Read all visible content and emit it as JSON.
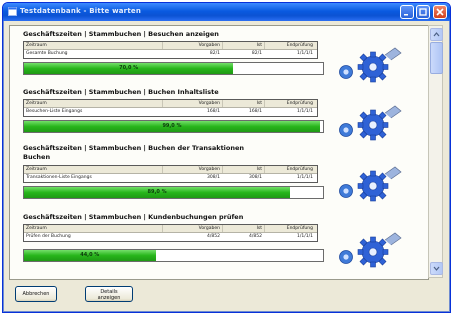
{
  "window": {
    "title": "Testdatenbank - Bitte warten",
    "icon": "app-window-icon",
    "controls": [
      "minimize-icon",
      "maximize-icon",
      "close-icon"
    ]
  },
  "table_headers": {
    "name": "Zeitraum",
    "col1": "Vorgaben",
    "col2": "Ist",
    "col3": "Endprüfung"
  },
  "sections": [
    {
      "title": "Geschäftszeiten | Stammbuchen | Besuchen anzeigen",
      "row": {
        "name": "Gesamte Buchung",
        "col1": "82/1",
        "col2": "82/1",
        "col3": "1/1/1/1"
      },
      "progress": {
        "value": 0.7,
        "label": "70,0 %"
      }
    },
    {
      "title": "Geschäftszeiten | Stammbuchen | Buchen Inhaltsliste",
      "row": {
        "name": "Besuchen-Liste Eingangs",
        "col1": "168/1",
        "col2": "168/1",
        "col3": "1/1/1/1"
      },
      "progress": {
        "value": 0.99,
        "label": "99,0 %"
      }
    },
    {
      "title": "Geschäftszeiten | Stammbuchen | Buchen der Transaktionen",
      "subtitle": "Buchen",
      "row": {
        "name": "Transaktionen-Liste Eingangs",
        "col1": "308/1",
        "col2": "308/1",
        "col3": "1/1/1/1"
      },
      "progress": {
        "value": 0.89,
        "label": "89,0 %"
      }
    },
    {
      "title": "Geschäftszeiten | Stammbuchen | Kundenbuchungen prüfen",
      "row": {
        "name": "Prüfen der Buchung",
        "col1": "4/852",
        "col2": "4/852",
        "col3": "1/1/1/1"
      },
      "progress": {
        "value": 0.44,
        "label": "44,0 %"
      }
    }
  ],
  "footer": {
    "cancel_label": "Abbrechen",
    "details_line1": "Details",
    "details_line2": "anzeigen"
  },
  "colors": {
    "progress": "#27b51a",
    "gear_large": "#2f62d6",
    "gear_small": "#3f7ad8",
    "title_bar": "#0a5ae0"
  }
}
